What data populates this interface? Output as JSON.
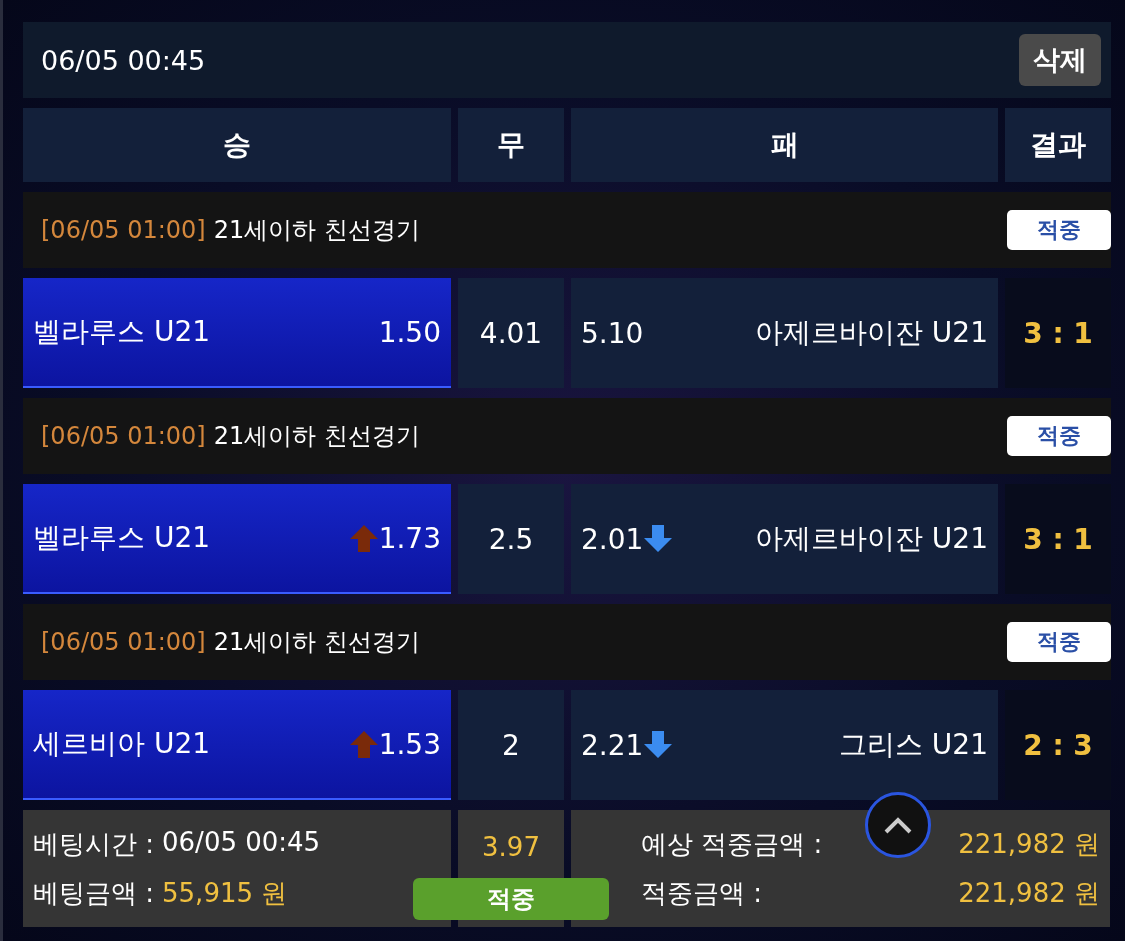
{
  "header": {
    "datetime": "06/05 00:45",
    "delete_button": "삭제"
  },
  "columns": [
    "승",
    "무",
    "패",
    "결과"
  ],
  "games": [
    {
      "time": "[06/05 01:00]",
      "league": "21세이하 친선경기",
      "status": "적중",
      "home": {
        "team": "벨라루스 U21",
        "odds": "1.50",
        "rising": false,
        "falling": false,
        "selected": true
      },
      "draw": {
        "odds": "4.01",
        "selected": false
      },
      "away": {
        "team": "아제르바이잔 U21",
        "odds": "5.10",
        "rising": false,
        "falling": false,
        "selected": false
      },
      "score": "3 : 1"
    },
    {
      "time": "[06/05 01:00]",
      "league": "21세이하 친선경기",
      "status": "적중",
      "home": {
        "team": "벨라루스 U21",
        "odds": "1.73",
        "rising": true,
        "falling": false,
        "selected": true
      },
      "draw": {
        "odds": "2.5",
        "selected": false
      },
      "away": {
        "team": "아제르바이잔 U21",
        "odds": "2.01",
        "rising": false,
        "falling": true,
        "selected": false
      },
      "score": "3 : 1"
    },
    {
      "time": "[06/05 01:00]",
      "league": "21세이하 친선경기",
      "status": "적중",
      "home": {
        "team": "세르비아 U21",
        "odds": "1.53",
        "rising": true,
        "falling": false,
        "selected": true
      },
      "draw": {
        "odds": "2",
        "selected": false
      },
      "away": {
        "team": "그리스 U21",
        "odds": "2.21",
        "rising": false,
        "falling": true,
        "selected": false
      },
      "score": "2 : 3"
    }
  ],
  "summary": {
    "bet_time_label": "베팅시간 :",
    "bet_time": "06/05 00:45",
    "bet_amount_label": "베팅금액 :",
    "bet_amount": "55,915 원",
    "total_odds": "3.97",
    "result": "적중",
    "expected_label": "예상 적중금액 :",
    "expected_value": "221,982 원",
    "won_label": "적중금액 :",
    "won_value": "221,982 원"
  }
}
